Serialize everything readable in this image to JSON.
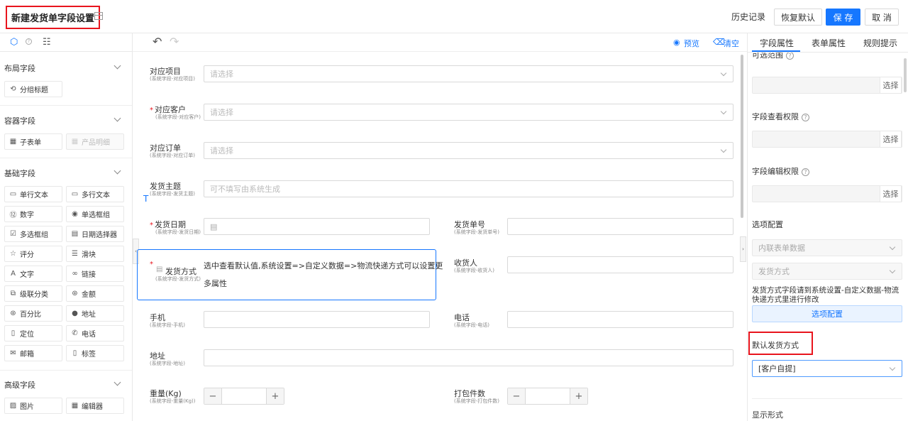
{
  "header": {
    "title": "新建发货单字段设置",
    "history": "历史记录",
    "restore_label": "恢复默认",
    "save_label": "保 存",
    "cancel_label": "取 消"
  },
  "left": {
    "sections": [
      {
        "title": "布局字段",
        "items": [
          {
            "label": "分组标题",
            "icon": "group-title-icon"
          }
        ]
      },
      {
        "title": "容器字段",
        "items": [
          {
            "label": "子表单",
            "icon": "table-icon"
          },
          {
            "label": "产品明细",
            "icon": "table-icon",
            "disabled": true
          }
        ]
      },
      {
        "title": "基础字段",
        "items": [
          {
            "label": "单行文本",
            "icon": "single-line-icon"
          },
          {
            "label": "多行文本",
            "icon": "multi-line-icon"
          },
          {
            "label": "数字",
            "icon": "number-icon"
          },
          {
            "label": "单选框组",
            "icon": "radio-icon"
          },
          {
            "label": "多选框组",
            "icon": "checkbox-icon"
          },
          {
            "label": "日期选择器",
            "icon": "calendar-icon"
          },
          {
            "label": "评分",
            "icon": "star-icon"
          },
          {
            "label": "滑块",
            "icon": "slider-icon"
          },
          {
            "label": "文字",
            "icon": "text-icon"
          },
          {
            "label": "链接",
            "icon": "link-icon"
          },
          {
            "label": "级联分类",
            "icon": "cascade-icon"
          },
          {
            "label": "金额",
            "icon": "money-icon"
          },
          {
            "label": "百分比",
            "icon": "percent-icon"
          },
          {
            "label": "地址",
            "icon": "location-icon"
          },
          {
            "label": "定位",
            "icon": "document-icon"
          },
          {
            "label": "电话",
            "icon": "phone-icon"
          },
          {
            "label": "邮箱",
            "icon": "mail-icon"
          },
          {
            "label": "标签",
            "icon": "bookmark-icon"
          }
        ]
      },
      {
        "title": "高级字段",
        "items": [
          {
            "label": "图片",
            "icon": "image-icon"
          },
          {
            "label": "编辑器",
            "icon": "editor-icon"
          }
        ]
      }
    ]
  },
  "toolbar": {
    "preview": "预览",
    "clear": "清空"
  },
  "form": {
    "project": {
      "label": "对应项目",
      "sub": "(系统字段-对应项目)",
      "placeholder": "请选择"
    },
    "customer": {
      "label": "对应客户",
      "sub": "(系统字段-对应客户)",
      "placeholder": "请选择"
    },
    "order": {
      "label": "对应订单",
      "sub": "(系统字段-对应订单)",
      "placeholder": "请选择"
    },
    "subject": {
      "label": "发货主题",
      "sub": "(系统字段-发货主题)",
      "placeholder": "可不填写由系统生成"
    },
    "date": {
      "label": "发货日期",
      "sub": "(系统字段-发货日期)"
    },
    "number": {
      "label": "发货单号",
      "sub": "(系统字段-发货单号)"
    },
    "method": {
      "label": "发货方式",
      "sub": "(系统字段-发货方式)",
      "note_line1": "选中查看默认值,系统设置=>自定义数据=>物流快递方式可以设置更",
      "note_line2": "多属性"
    },
    "receiver": {
      "label": "收货人",
      "sub": "(系统字段-收货人)"
    },
    "mobile": {
      "label": "手机",
      "sub": "(系统字段-手机)"
    },
    "phone": {
      "label": "电话",
      "sub": "(系统字段-电话)"
    },
    "address": {
      "label": "地址",
      "sub": "(系统字段-地址)"
    },
    "weight": {
      "label": "重量(Kg)",
      "sub": "(系统字段-重量(Kg))"
    },
    "packages": {
      "label": "打包件数",
      "sub": "(系统字段-打包件数)"
    }
  },
  "right": {
    "tabs": [
      "字段属性",
      "表单属性",
      "规则提示"
    ],
    "scope_label": "可选范围",
    "pick": "选择",
    "view_perm": "字段查看权限",
    "edit_perm": "字段编辑权限",
    "option_config": "选项配置",
    "option_source": "内联表单数据",
    "option_field": "发货方式",
    "option_note": "发货方式字段请到系统设置-自定义数据-物流快递方式里进行修改",
    "option_btn": "选项配置",
    "default_label": "默认发货方式",
    "default_value": "[客户自提]",
    "display_label": "显示形式"
  },
  "colors": {
    "primary": "#1677ff",
    "highlight": "#e8141d"
  }
}
